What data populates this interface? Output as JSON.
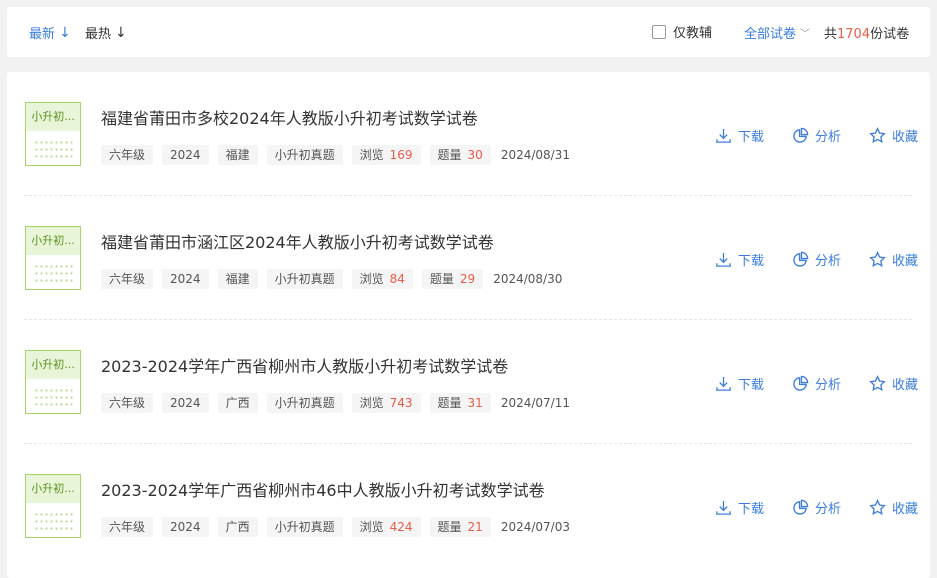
{
  "header": {
    "sort_latest": "最新",
    "sort_hot": "最热",
    "only_counseling": "仅教辅",
    "filter_all": "全部试卷",
    "total_prefix": "共",
    "total_count": "1704",
    "total_suffix": "份试卷"
  },
  "items": [
    {
      "thumb_text": "小升初...",
      "title": "福建省莆田市多校2024年人教版小升初考试数学试卷",
      "grade": "六年级",
      "year": "2024",
      "region": "福建",
      "type": "小升初真题",
      "views_label": "浏览",
      "views": "169",
      "questions_label": "题量",
      "questions": "30",
      "date": "2024/08/31"
    },
    {
      "thumb_text": "小升初...",
      "title": "福建省莆田市涵江区2024年人教版小升初考试数学试卷",
      "grade": "六年级",
      "year": "2024",
      "region": "福建",
      "type": "小升初真题",
      "views_label": "浏览",
      "views": "84",
      "questions_label": "题量",
      "questions": "29",
      "date": "2024/08/30"
    },
    {
      "thumb_text": "小升初...",
      "title": "2023-2024学年广西省柳州市人教版小升初考试数学试卷",
      "grade": "六年级",
      "year": "2024",
      "region": "广西",
      "type": "小升初真题",
      "views_label": "浏览",
      "views": "743",
      "questions_label": "题量",
      "questions": "31",
      "date": "2024/07/11"
    },
    {
      "thumb_text": "小升初...",
      "title": "2023-2024学年广西省柳州市46中人教版小升初考试数学试卷",
      "grade": "六年级",
      "year": "2024",
      "region": "广西",
      "type": "小升初真题",
      "views_label": "浏览",
      "views": "424",
      "questions_label": "题量",
      "questions": "21",
      "date": "2024/07/03"
    }
  ],
  "actions": {
    "download": "下载",
    "analyze": "分析",
    "favorite": "收藏"
  },
  "icons": {
    "download": "download-icon",
    "analyze": "pie-chart-icon",
    "favorite": "star-icon",
    "sort": "arrow-down-icon",
    "dropdown": "chevron-down-icon"
  },
  "colors": {
    "accent": "#3b7ddd",
    "count_red": "#e85c4a",
    "thumb_green": "#a6d46b"
  }
}
